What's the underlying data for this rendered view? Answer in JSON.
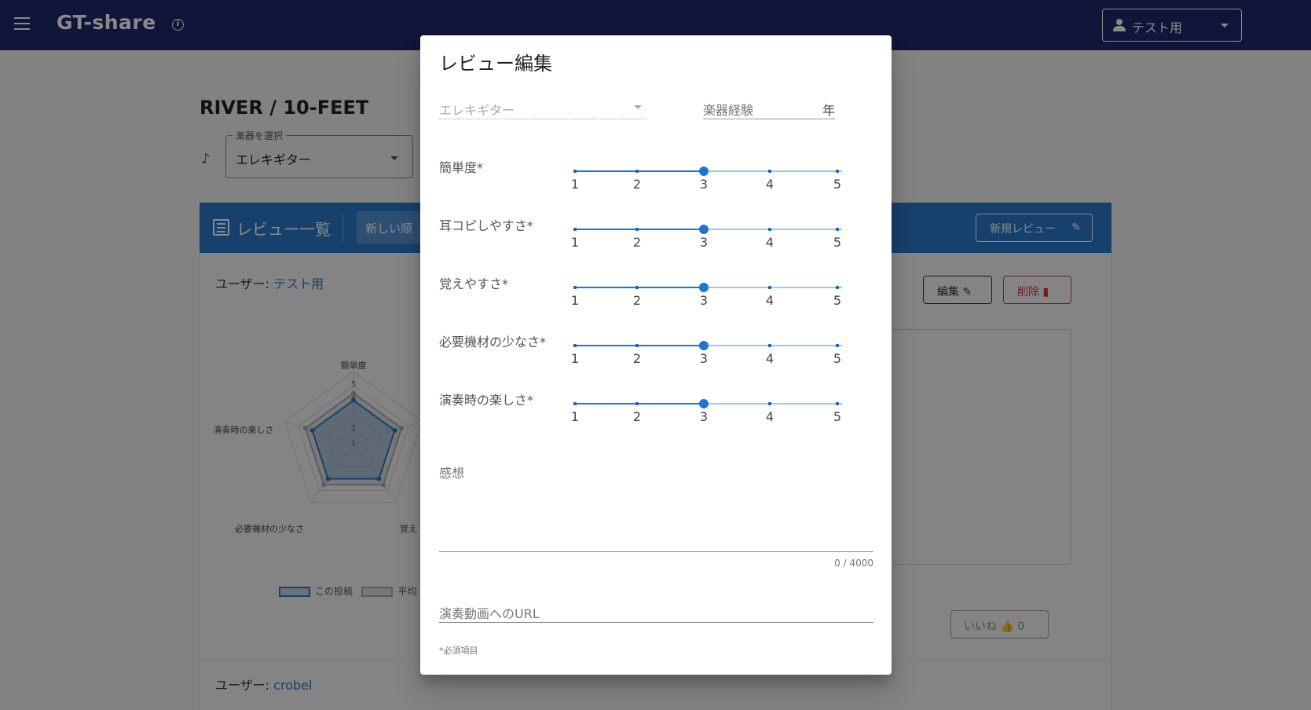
{
  "appbar": {
    "title": "GT-share",
    "info_icon": "info-icon",
    "user_label": "テスト用"
  },
  "page": {
    "title": "RIVER / 10-FEET",
    "instrument_select": {
      "legend": "楽器を選択",
      "value": "エレキギター"
    },
    "review_header": {
      "title": "レビュー一覧",
      "sort_label": "新しい順",
      "new_review_label": "新規レビュー"
    },
    "card": {
      "user_prefix": "ユーザー:",
      "user_name": "テスト用",
      "edit_label": "編集",
      "delete_label": "削除",
      "like_label": "いいね",
      "like_count": "0",
      "radar": {
        "axes": [
          "簡単度",
          "耳コピしやすさ",
          "覚えやすさ",
          "必要機材の少なさ",
          "演奏時の楽しさ"
        ],
        "visible_axis_labels": {
          "top": "簡単度",
          "left": "演奏時の楽しさ",
          "bottom_left": "必要機材の少なさ",
          "bottom_right": "覚え"
        },
        "scale_ticks": [
          "5",
          "4",
          "2",
          "1"
        ],
        "this_post_values": [
          3,
          3,
          3,
          3,
          3
        ],
        "average_values": [
          3.5,
          3.5,
          3.5,
          3.5,
          3.5
        ]
      },
      "legend": {
        "this_post": "この投稿",
        "average": "平均"
      }
    },
    "card2": {
      "user_prefix": "ユーザー:",
      "user_name": "crobel"
    }
  },
  "dialog": {
    "title": "レビュー編集",
    "instrument_placeholder": "エレキギター",
    "experience_label": "楽器経験",
    "experience_suffix": "年",
    "sliders": [
      {
        "label": "簡単度*",
        "value": 3
      },
      {
        "label": "耳コピしやすさ*",
        "value": 3
      },
      {
        "label": "覚えやすさ*",
        "value": 3
      },
      {
        "label": "必要機材の少なさ*",
        "value": 3
      },
      {
        "label": "演奏時の楽しさ*",
        "value": 3
      }
    ],
    "slider_marks": [
      "1",
      "2",
      "3",
      "4",
      "5"
    ],
    "thoughts_label": "感想",
    "thoughts_count": "0 / 4000",
    "url_label": "演奏動画へのURL",
    "required_note": "*必須項目"
  },
  "colors": {
    "appbar": "#1f2a6b",
    "accent": "#2979c9",
    "slider": "#1976d2",
    "danger": "#d33333"
  }
}
